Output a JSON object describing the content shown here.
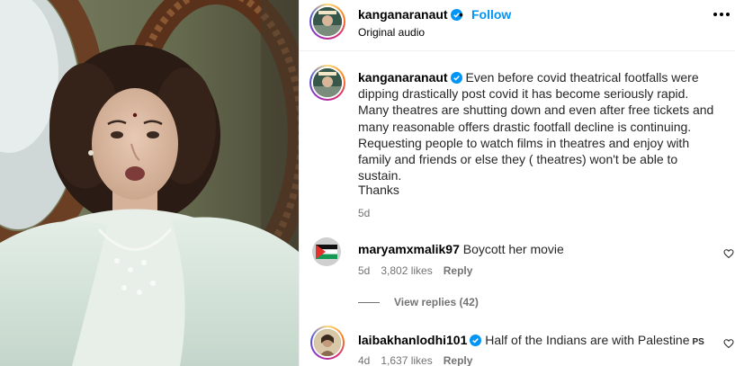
{
  "post": {
    "username": "kanganaranaut",
    "follow_label": "Follow",
    "dot": "•",
    "subtitle": "Original audio"
  },
  "caption": {
    "username": "kanganaranaut",
    "text": "Even before covid theatrical footfalls were dipping drastically post covid it has become seriously rapid. Many theatres are shutting down and even after free tickets and many reasonable offers drastic footfall decline is continuing. Requesting people to watch films in theatres and enjoy with family and friends or else they ( theatres) won't be able to sustain.",
    "thanks": "Thanks",
    "age": "5d"
  },
  "comments": [
    {
      "username": "maryamxmalik97",
      "text": "Boycott her movie",
      "age": "5d",
      "likes": "3,802 likes",
      "reply": "Reply",
      "view_replies": "View replies (42)"
    },
    {
      "username": "laibakhanlodhi101",
      "text": "Half of the Indians are with Palestine",
      "trailing": "PS",
      "age": "4d",
      "likes": "1,637 likes",
      "reply": "Reply"
    }
  ],
  "colors": {
    "accent": "#0095f6",
    "muted": "#737373",
    "verified": "#0095f6"
  }
}
